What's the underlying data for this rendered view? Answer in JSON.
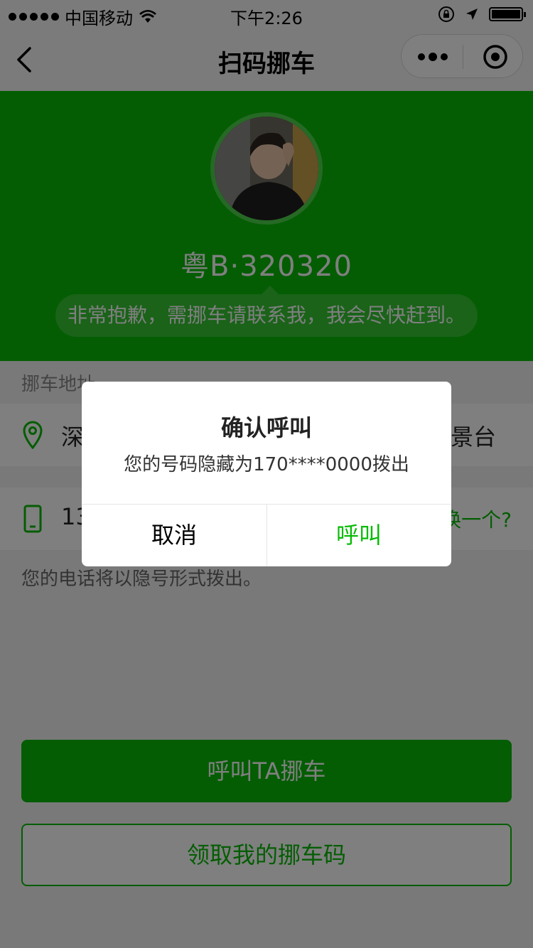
{
  "status_bar": {
    "carrier": "中国移动",
    "time": "下午2:26"
  },
  "nav": {
    "title": "扫码挪车"
  },
  "profile": {
    "plate": "粤B·320320",
    "message": "非常抱歉，需挪车请联系我，我会尽快赶到。"
  },
  "address": {
    "section_label": "挪车地址",
    "value_start": "深",
    "value_end": "景台"
  },
  "phone": {
    "value_start": "13",
    "change_link": "换一个?",
    "hint": "您的电话将以隐号形式拨出。"
  },
  "actions": {
    "call_label": "呼叫TA挪车",
    "get_code_label": "领取我的挪车码"
  },
  "dialog": {
    "title": "确认呼叫",
    "content": "您的号码隐藏为170****0000拨出",
    "cancel": "取消",
    "confirm": "呼叫"
  },
  "colors": {
    "brand_green": "#09bb07",
    "mask": "rgba(0,0,0,0.5)"
  }
}
